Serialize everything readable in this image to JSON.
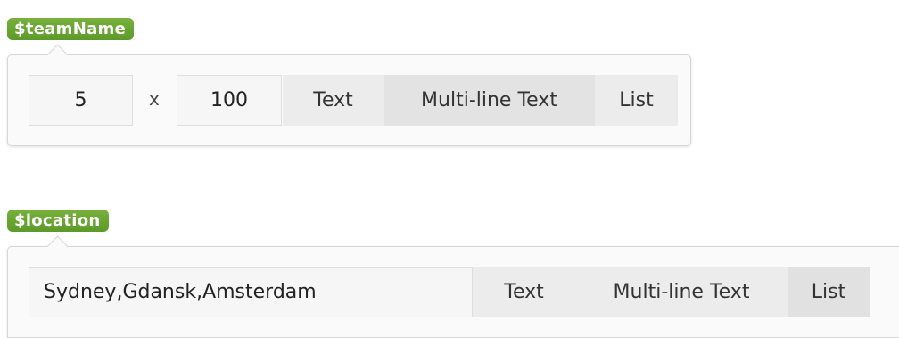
{
  "team_name": {
    "variable_label": "$teamName",
    "rows_value": "5",
    "times_symbol": "x",
    "columns_value": "100",
    "type_options": [
      "Text",
      "Multi-line Text",
      "List"
    ],
    "selected_type": "Multi-line Text"
  },
  "location": {
    "variable_label": "$location",
    "value": "Sydney,Gdansk,Amsterdam",
    "type_options": [
      "Text",
      "Multi-line Text",
      "List"
    ],
    "selected_type": "List"
  },
  "colors": {
    "pill_green": "#6aa532",
    "panel_bg": "#fafafa",
    "segment_bg": "#ececec"
  }
}
